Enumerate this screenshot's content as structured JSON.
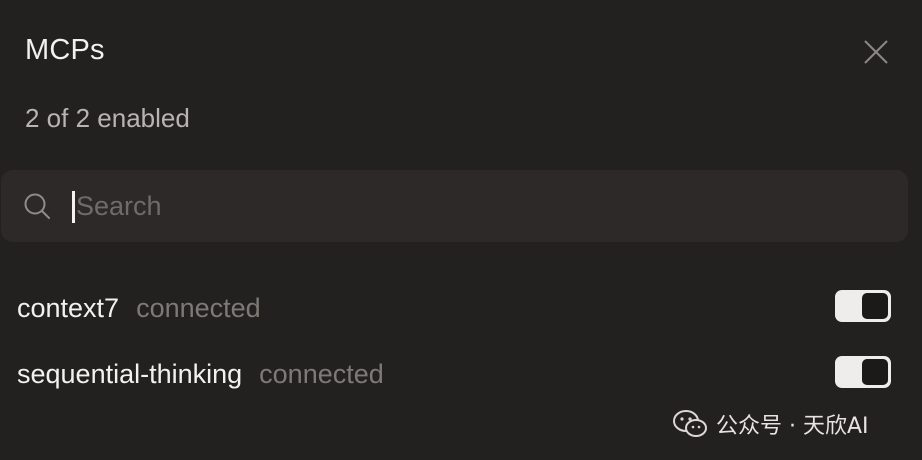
{
  "header": {
    "title": "MCPs",
    "subtitle": "2 of 2 enabled",
    "close_icon": "close-icon"
  },
  "search": {
    "placeholder": "Search",
    "value": "",
    "icon": "search-icon"
  },
  "servers": [
    {
      "name": "context7",
      "status": "connected",
      "enabled": true
    },
    {
      "name": "sequential-thinking",
      "status": "connected",
      "enabled": true
    }
  ],
  "watermark": {
    "text": "公众号 · 天欣AI",
    "icon": "wechat-logo-icon"
  },
  "colors": {
    "background": "#232120",
    "search_bg": "#2c2928",
    "toggle_on": "#efedeb",
    "status_text": "#7d7975"
  }
}
